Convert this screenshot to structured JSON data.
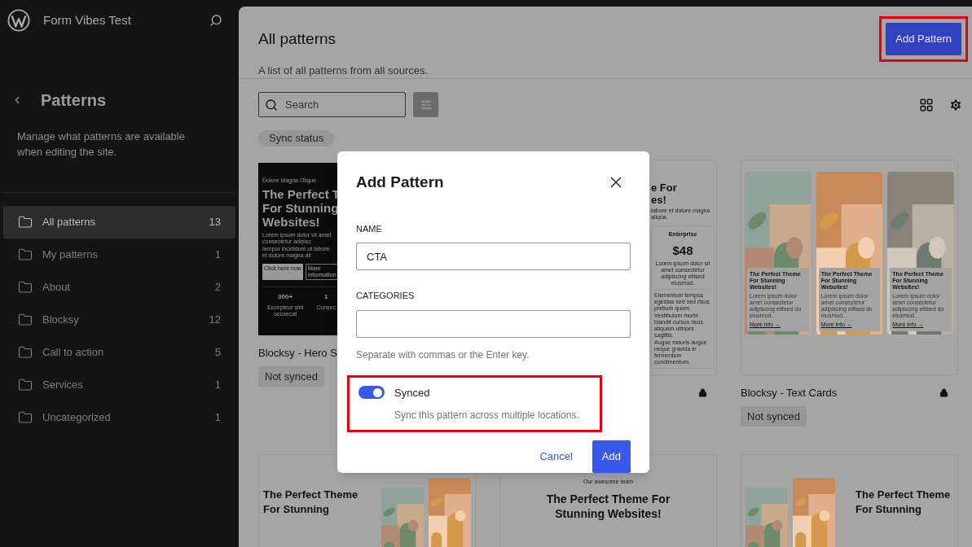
{
  "site": {
    "title": "Form Vibes Test"
  },
  "sidebar": {
    "title": "Patterns",
    "description": "Manage what patterns are available when editing the site.",
    "items": [
      {
        "label": "All patterns",
        "count": "13",
        "selected": true
      },
      {
        "label": "My patterns",
        "count": "1",
        "selected": false
      },
      {
        "label": "About",
        "count": "2",
        "selected": false
      },
      {
        "label": "Blocksy",
        "count": "12",
        "selected": false
      },
      {
        "label": "Call to action",
        "count": "5",
        "selected": false
      },
      {
        "label": "Services",
        "count": "1",
        "selected": false
      },
      {
        "label": "Uncategorized",
        "count": "1",
        "selected": false
      }
    ]
  },
  "header": {
    "title": "All patterns",
    "subtitle": "A list of all patterns from all sources.",
    "add_button": {
      "label": "Add Pattern",
      "highlighted": true
    }
  },
  "toolbar": {
    "search": {
      "placeholder": "Search"
    },
    "filter_chip": "Sync status"
  },
  "patterns": [
    {
      "kind": "hero",
      "title": "Blocksy - Hero S",
      "badge": "Not synced",
      "preview": {
        "eyebrow": "Dolore Magna Olique",
        "heading": [
          "The Perfect T",
          "For Stunning",
          "Websites!"
        ],
        "body": [
          "Lorem ipsum dolor sit amet consectetur adipisc",
          "tempor incididunt ut labore et dolore magna ali"
        ],
        "buttons": [
          "Click here now",
          "More information"
        ],
        "stats": [
          {
            "value": "300+",
            "label": "Excepteur sint occaecat"
          },
          {
            "value": "1",
            "label": "Consec"
          }
        ]
      }
    },
    {
      "kind": "pricing",
      "locked": true,
      "preview": {
        "heading": [
          "e For",
          "es!"
        ],
        "body": "tabore et dolore magna aliqua.",
        "plan": "Enterprise",
        "price": "$48",
        "description": "Lorem ipsum dolor sit amet consectetur adipiscing elitsed eiusmod.",
        "features": [
          "Elementum tempus egestas sed sed risus pretium quam.",
          "Vestibulum morbi blandit cursus risus aliquam ultrices sagittis.",
          "Augue mauris augue neque gravida in fermentum condimentum."
        ]
      }
    },
    {
      "kind": "cards",
      "title": "Blocksy - Text Cards",
      "badge": "Not synced",
      "locked": true,
      "preview": {
        "tiles": [
          {
            "heading": "The Perfect Theme For Stunning Websites!",
            "body": "Lorem ipsum dolor amet consectetur adipiscing elitsed do eiusmod.",
            "link": "More info →"
          },
          {
            "heading": "The Perfect Theme For Stunning Websites!",
            "body": "Lorem ipsum dolor amet consectetur adipiscing elitsed do eiusmod.",
            "link": "More info →"
          },
          {
            "heading": "The Perfect Theme For Stunning Websites!",
            "body": "Lorem ipsum dolor amet consectetur adipiscing elitsed do eiusmod.",
            "link": "More info →"
          }
        ]
      }
    },
    {
      "kind": "split",
      "preview": {
        "heading": "The Perfect Theme For Stunning"
      }
    },
    {
      "kind": "centered",
      "preview": {
        "eyebrow": "Our awesome team",
        "heading": "The Perfect Theme For Stunning Websites!"
      }
    },
    {
      "kind": "split-reverse",
      "preview": {
        "heading": "The Perfect Theme For Stunning"
      }
    }
  ],
  "dialog": {
    "title": "Add Pattern",
    "name": {
      "label": "NAME",
      "value": "CTA"
    },
    "categories": {
      "label": "CATEGORIES",
      "help": "Separate with commas or the Enter key."
    },
    "sync": {
      "label": "Synced",
      "help": "Sync this pattern across multiple locations.",
      "on": true,
      "highlighted": true
    },
    "buttons": {
      "cancel": "Cancel",
      "confirm": "Add"
    }
  }
}
